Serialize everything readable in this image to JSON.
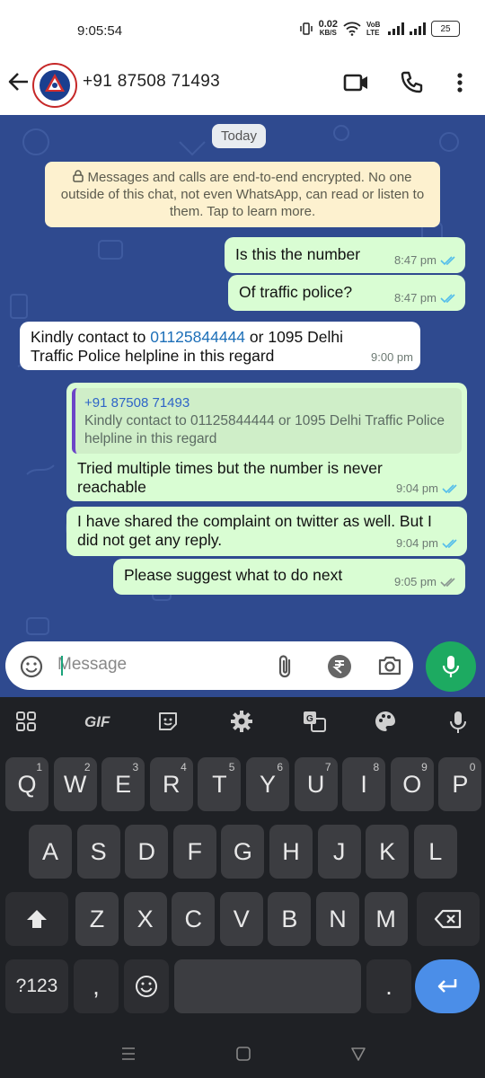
{
  "status_bar": {
    "time": "9:05:54",
    "net_speed": "0.02",
    "net_unit": "KB/S",
    "volte": "VoB LTE",
    "battery": "25"
  },
  "header": {
    "contact": "+91 87508 71493",
    "icons": [
      "back-arrow-icon",
      "video-call-icon",
      "voice-call-icon",
      "more-vert-icon"
    ]
  },
  "chat": {
    "date_chip": "Today",
    "encryption_notice": "Messages and calls are end-to-end encrypted. No one outside of this chat, not even WhatsApp, can read or listen to them. Tap to learn more.",
    "messages": [
      {
        "dir": "out",
        "text": "Is this the number",
        "time": "8:47 pm",
        "status": "read"
      },
      {
        "dir": "out",
        "text": "Of traffic police?",
        "time": "8:47 pm",
        "status": "read"
      },
      {
        "dir": "in",
        "text_pre": "Kindly contact to ",
        "link": "01125844444",
        "text_post": " or 1095 Delhi Traffic Police helpline in this regard",
        "time": "9:00 pm"
      },
      {
        "dir": "out",
        "quote_name": "+91 87508 71493",
        "quote_text": "Kindly contact to 01125844444 or 1095 Delhi Traffic Police helpline in this regard",
        "text": "Tried multiple times but the number is never reachable",
        "time": "9:04 pm",
        "status": "read"
      },
      {
        "dir": "out",
        "text": "I have shared the complaint on twitter as well. But I did not get any reply.",
        "time": "9:04 pm",
        "status": "read"
      },
      {
        "dir": "out",
        "text": "Please suggest what to do next",
        "time": "9:05 pm",
        "status": "delivered"
      }
    ]
  },
  "composer": {
    "placeholder": "Message",
    "icons": [
      "emoji-icon",
      "attach-icon",
      "rupee-icon",
      "camera-icon",
      "mic-icon"
    ]
  },
  "keyboard": {
    "toolbar": [
      "apps-grid-icon",
      "GIF",
      "sticker-icon",
      "settings-icon",
      "translate-icon",
      "palette-icon",
      "voice-input-icon"
    ],
    "row1": [
      "Q",
      "W",
      "E",
      "R",
      "T",
      "Y",
      "U",
      "I",
      "O",
      "P"
    ],
    "row1_hints": [
      "1",
      "2",
      "3",
      "4",
      "5",
      "6",
      "7",
      "8",
      "9",
      "0"
    ],
    "row2": [
      "A",
      "S",
      "D",
      "F",
      "G",
      "H",
      "J",
      "K",
      "L"
    ],
    "row3": [
      "Z",
      "X",
      "C",
      "V",
      "B",
      "N",
      "M"
    ],
    "symbols_key": "?123",
    "comma_key": ",",
    "period_key": "."
  },
  "colors": {
    "chat_bg": "#2f4a8f",
    "outgoing_bubble": "#d9fdd3",
    "incoming_bubble": "#ffffff",
    "read_tick": "#53bdeb",
    "mic_button": "#1daa61",
    "keyboard_bg": "#1f2125",
    "enter_key": "#4b8ee8"
  }
}
